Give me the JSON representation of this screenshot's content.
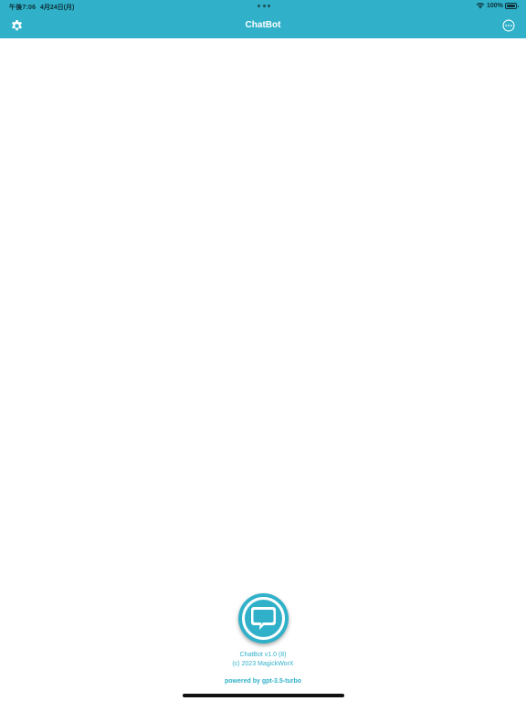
{
  "status_bar": {
    "time": "午後7:06",
    "date": "4月24日(月)",
    "battery_percent": "100%",
    "battery_level": 1.0
  },
  "nav": {
    "title": "ChatBot",
    "left_icon": "gear-icon",
    "right_icon": "ellipsis-circle-icon"
  },
  "footer": {
    "version": "ChatBot v1.0 (8)",
    "copyright": "(c) 2023 MagickWorX",
    "powered_by": "powered by gpt-3.5-turbo",
    "logo_icon": "chat-bubble-icon"
  },
  "colors": {
    "accent": "#30b1c9",
    "background": "#ffffff",
    "status_text": "#0c2d35"
  }
}
